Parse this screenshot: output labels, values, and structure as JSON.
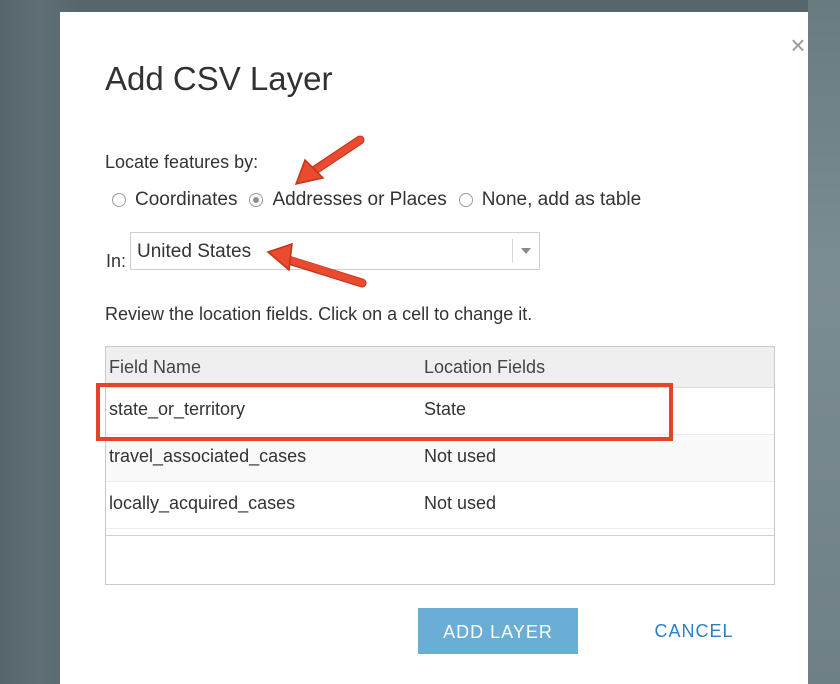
{
  "dialog": {
    "title": "Add CSV Layer",
    "close_symbol": "×"
  },
  "locate": {
    "label": "Locate features by:",
    "options": [
      {
        "label": "Coordinates",
        "checked": false
      },
      {
        "label": "Addresses or Places",
        "checked": true
      },
      {
        "label": "None, add as table",
        "checked": false
      }
    ]
  },
  "country": {
    "label": "In:",
    "selected": "United States"
  },
  "review": {
    "text": "Review the location fields. Click on a cell to change it."
  },
  "table": {
    "columns": [
      "Field Name",
      "Location Fields"
    ],
    "rows": [
      {
        "field": "state_or_territory",
        "location": "State"
      },
      {
        "field": "travel_associated_cases",
        "location": "Not used"
      },
      {
        "field": "locally_acquired_cases",
        "location": "Not used"
      }
    ]
  },
  "buttons": {
    "add": "ADD LAYER",
    "cancel": "CANCEL"
  },
  "colors": {
    "primary_button": "#6aaed6",
    "link": "#2b7fc3",
    "annotation_red": "#e8412b"
  }
}
